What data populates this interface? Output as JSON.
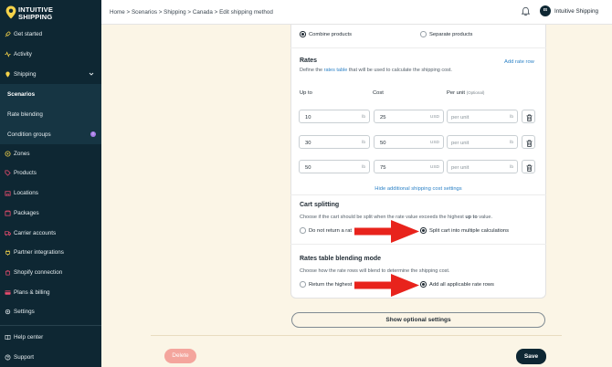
{
  "app": {
    "logo_line1": "INTUITIVE",
    "logo_line2": "SHIPPING"
  },
  "sidebar": {
    "items": [
      {
        "label": "Get started",
        "icon": "rocket-icon"
      },
      {
        "label": "Activity",
        "icon": "activity-icon"
      },
      {
        "label": "Shipping",
        "icon": "shipping-icon"
      },
      {
        "label": "Scenarios"
      },
      {
        "label": "Rate blending"
      },
      {
        "label": "Condition groups",
        "badge": "!"
      },
      {
        "label": "Zones",
        "icon": "zones-icon"
      },
      {
        "label": "Products",
        "icon": "tag-icon"
      },
      {
        "label": "Locations",
        "icon": "building-icon"
      },
      {
        "label": "Packages",
        "icon": "box-icon"
      },
      {
        "label": "Carrier accounts",
        "icon": "truck-icon"
      },
      {
        "label": "Partner integrations",
        "icon": "plug-icon"
      },
      {
        "label": "Shopify connection",
        "icon": "shopify-icon"
      },
      {
        "label": "Plans & billing",
        "icon": "card-icon"
      },
      {
        "label": "Settings",
        "icon": "gear-icon"
      },
      {
        "label": "Help center",
        "icon": "book-icon"
      },
      {
        "label": "Support",
        "icon": "support-icon"
      }
    ],
    "colors": {
      "background": "#0e2733",
      "logo": "#f5d34a"
    }
  },
  "header": {
    "breadcrumb": "Home > Scenarios > Shipping > Canada > Edit shipping method",
    "avatar_initials": "IS",
    "user_name": "Intuitive Shipping"
  },
  "form": {
    "combine_label": "Combine products",
    "separate_label": "Separate products",
    "rates_title": "Rates",
    "rates_desc_before": "Define the ",
    "rates_desc_link": "rates table",
    "rates_desc_after": " that will be used to calculate the shipping cost.",
    "add_rate_row": "Add rate row",
    "col_up_to": "Up to",
    "col_cost": "Cost",
    "col_per_unit": "Per unit",
    "col_optional": "(Optional)",
    "rows": [
      {
        "up_to": "10",
        "up_to_unit": "lb",
        "cost": "25",
        "currency": "USD",
        "per_unit_placeholder": "per unit",
        "per_unit_unit": "lb"
      },
      {
        "up_to": "30",
        "up_to_unit": "lb",
        "cost": "50",
        "currency": "USD",
        "per_unit_placeholder": "per unit",
        "per_unit_unit": "lb"
      },
      {
        "up_to": "50",
        "up_to_unit": "lb",
        "cost": "75",
        "currency": "USD",
        "per_unit_placeholder": "per unit",
        "per_unit_unit": "lb"
      }
    ],
    "hide_settings": "Hide additional shipping cost settings",
    "cart_title": "Cart splitting",
    "cart_desc_before": "Choose if the cart should be split when the rate value exceeds the highest ",
    "cart_desc_bold": "up to",
    "cart_desc_after": " value.",
    "cart_opt1": "Do not return a rat",
    "cart_opt2": "Split cart into multiple calculations",
    "blend_title": "Rates table blending mode",
    "blend_desc": "Choose how the rate rows will blend to determine the shipping cost.",
    "blend_opt1": "Return the highest",
    "blend_opt2": "Add all applicable rate rows"
  },
  "buttons": {
    "optional_settings": "Show optional settings",
    "delete": "Delete",
    "save": "Save"
  },
  "colors": {
    "accent_link": "#2e83c7",
    "arrow": "#e8231c",
    "delete": "#f4a59d",
    "save": "#0e2733",
    "page_bg": "#fbf5e6"
  }
}
